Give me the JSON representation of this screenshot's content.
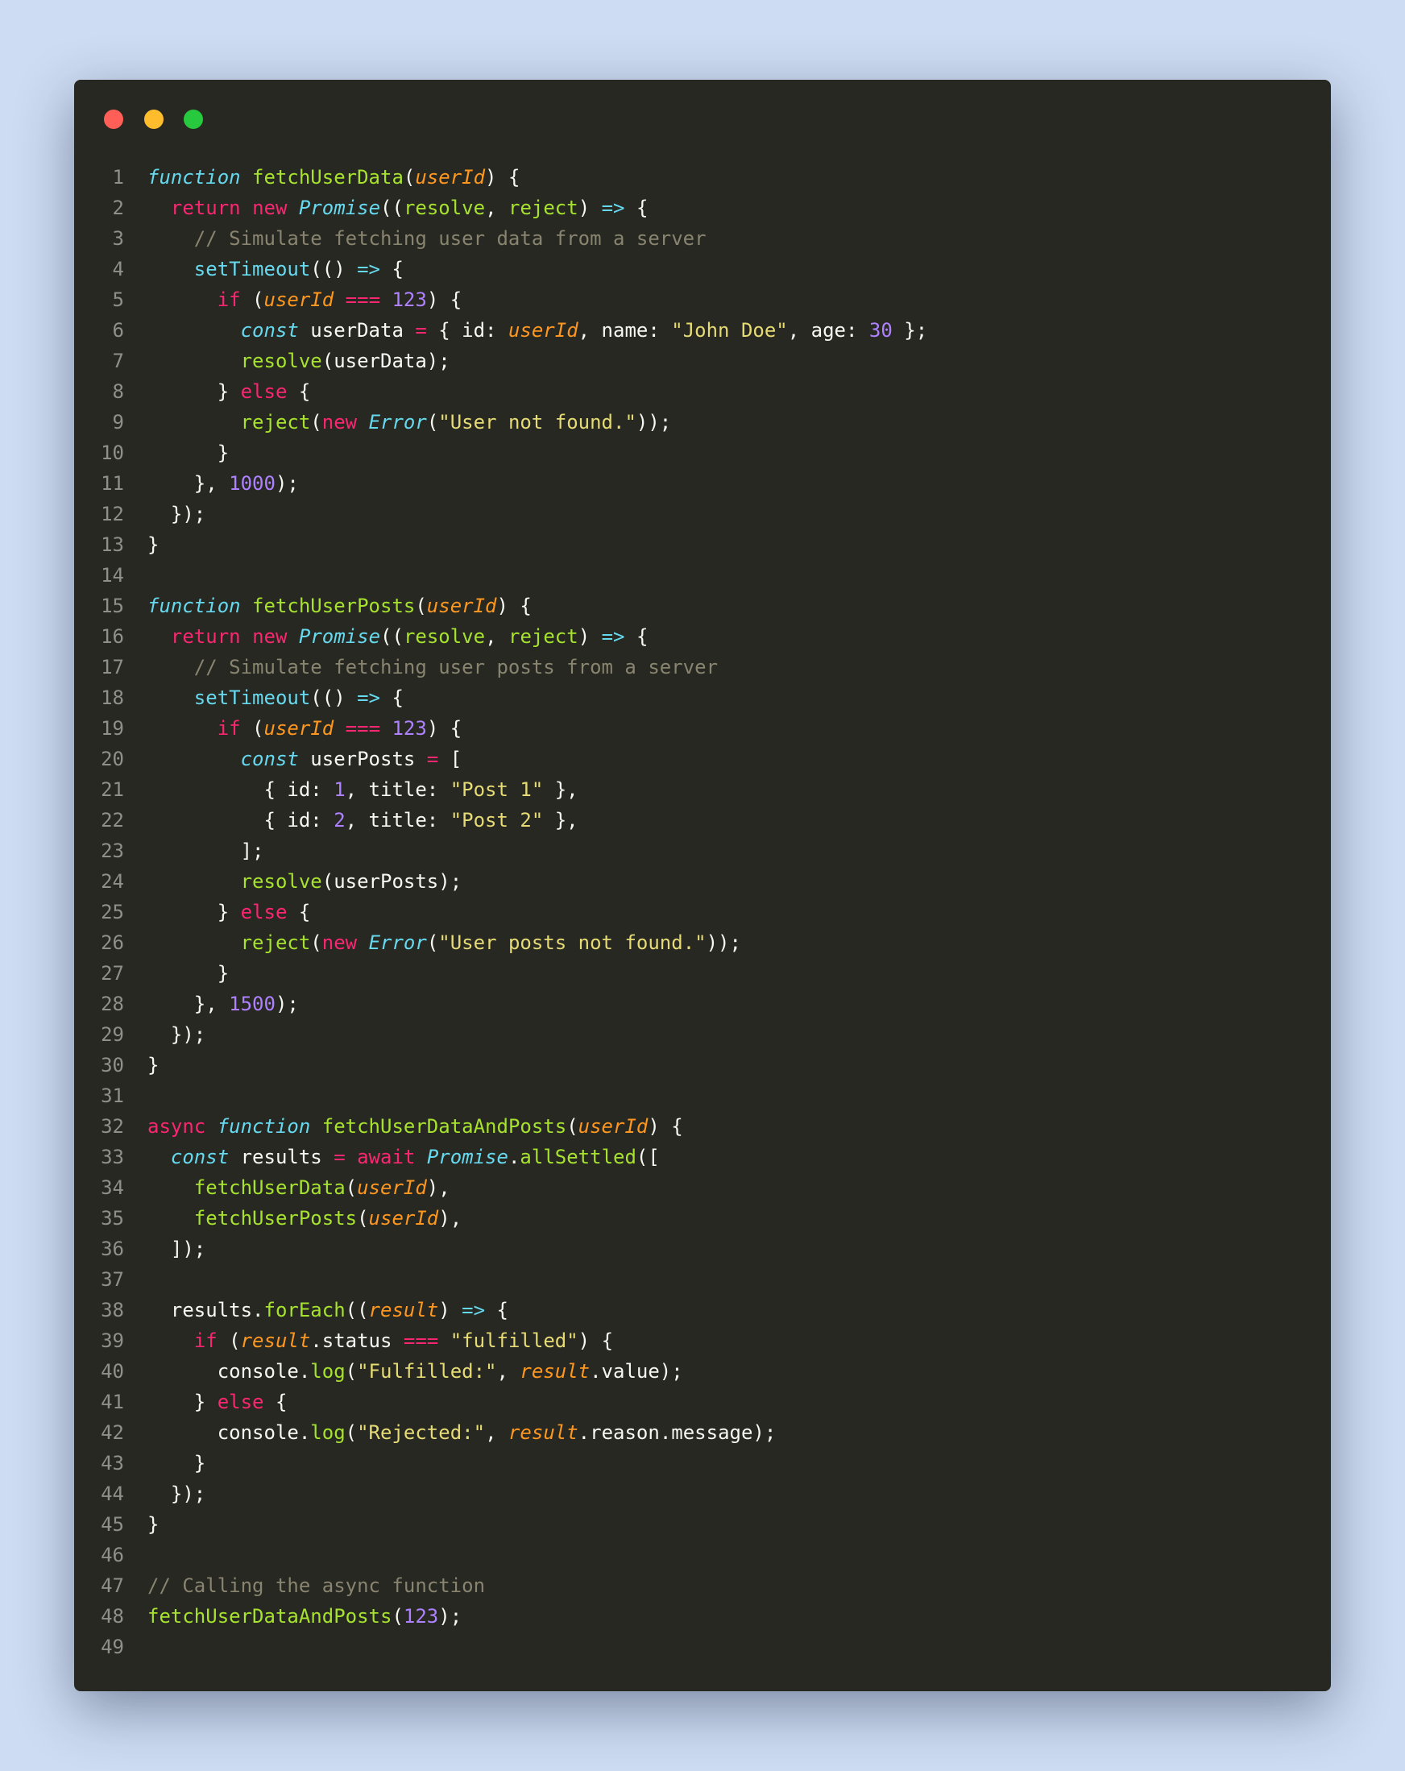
{
  "window": {
    "buttons": [
      {
        "name": "close",
        "color": "#ff5f56"
      },
      {
        "name": "minimize",
        "color": "#ffbd2e"
      },
      {
        "name": "maximize",
        "color": "#27c93f"
      }
    ]
  },
  "code": {
    "language": "javascript",
    "lines": [
      [
        [
          "st",
          "function"
        ],
        [
          "p",
          " "
        ],
        [
          "fn",
          "fetchUserData"
        ],
        [
          "p",
          "("
        ],
        [
          "prm",
          "userId"
        ],
        [
          "p",
          ") {"
        ]
      ],
      [
        [
          "p",
          "  "
        ],
        [
          "kw",
          "return"
        ],
        [
          "p",
          " "
        ],
        [
          "kw",
          "new"
        ],
        [
          "p",
          " "
        ],
        [
          "cls",
          "Promise"
        ],
        [
          "p",
          "(("
        ],
        [
          "fn",
          "resolve"
        ],
        [
          "p",
          ", "
        ],
        [
          "fn",
          "reject"
        ],
        [
          "p",
          ") "
        ],
        [
          "arrow",
          "=>"
        ],
        [
          "p",
          " {"
        ]
      ],
      [
        [
          "p",
          "    "
        ],
        [
          "cmt",
          "// Simulate fetching user data from a server"
        ]
      ],
      [
        [
          "p",
          "    "
        ],
        [
          "call",
          "setTimeout"
        ],
        [
          "p",
          "(() "
        ],
        [
          "arrow",
          "=>"
        ],
        [
          "p",
          " {"
        ]
      ],
      [
        [
          "p",
          "      "
        ],
        [
          "kw",
          "if"
        ],
        [
          "p",
          " ("
        ],
        [
          "prm",
          "userId"
        ],
        [
          "p",
          " "
        ],
        [
          "op",
          "==="
        ],
        [
          "p",
          " "
        ],
        [
          "num",
          "123"
        ],
        [
          "p",
          ") {"
        ]
      ],
      [
        [
          "p",
          "        "
        ],
        [
          "st",
          "const"
        ],
        [
          "p",
          " userData "
        ],
        [
          "op",
          "="
        ],
        [
          "p",
          " { id: "
        ],
        [
          "prm",
          "userId"
        ],
        [
          "p",
          ", name: "
        ],
        [
          "str",
          "\"John Doe\""
        ],
        [
          "p",
          ", age: "
        ],
        [
          "num",
          "30"
        ],
        [
          "p",
          " };"
        ]
      ],
      [
        [
          "p",
          "        "
        ],
        [
          "fn",
          "resolve"
        ],
        [
          "p",
          "(userData);"
        ]
      ],
      [
        [
          "p",
          "      } "
        ],
        [
          "kw",
          "else"
        ],
        [
          "p",
          " {"
        ]
      ],
      [
        [
          "p",
          "        "
        ],
        [
          "fn",
          "reject"
        ],
        [
          "p",
          "("
        ],
        [
          "kw",
          "new"
        ],
        [
          "p",
          " "
        ],
        [
          "cls",
          "Error"
        ],
        [
          "p",
          "("
        ],
        [
          "str",
          "\"User not found.\""
        ],
        [
          "p",
          "));"
        ]
      ],
      [
        [
          "p",
          "      }"
        ]
      ],
      [
        [
          "p",
          "    }, "
        ],
        [
          "num",
          "1000"
        ],
        [
          "p",
          ");"
        ]
      ],
      [
        [
          "p",
          "  });"
        ]
      ],
      [
        [
          "p",
          "}"
        ]
      ],
      [],
      [
        [
          "st",
          "function"
        ],
        [
          "p",
          " "
        ],
        [
          "fn",
          "fetchUserPosts"
        ],
        [
          "p",
          "("
        ],
        [
          "prm",
          "userId"
        ],
        [
          "p",
          ") {"
        ]
      ],
      [
        [
          "p",
          "  "
        ],
        [
          "kw",
          "return"
        ],
        [
          "p",
          " "
        ],
        [
          "kw",
          "new"
        ],
        [
          "p",
          " "
        ],
        [
          "cls",
          "Promise"
        ],
        [
          "p",
          "(("
        ],
        [
          "fn",
          "resolve"
        ],
        [
          "p",
          ", "
        ],
        [
          "fn",
          "reject"
        ],
        [
          "p",
          ") "
        ],
        [
          "arrow",
          "=>"
        ],
        [
          "p",
          " {"
        ]
      ],
      [
        [
          "p",
          "    "
        ],
        [
          "cmt",
          "// Simulate fetching user posts from a server"
        ]
      ],
      [
        [
          "p",
          "    "
        ],
        [
          "call",
          "setTimeout"
        ],
        [
          "p",
          "(() "
        ],
        [
          "arrow",
          "=>"
        ],
        [
          "p",
          " {"
        ]
      ],
      [
        [
          "p",
          "      "
        ],
        [
          "kw",
          "if"
        ],
        [
          "p",
          " ("
        ],
        [
          "prm",
          "userId"
        ],
        [
          "p",
          " "
        ],
        [
          "op",
          "==="
        ],
        [
          "p",
          " "
        ],
        [
          "num",
          "123"
        ],
        [
          "p",
          ") {"
        ]
      ],
      [
        [
          "p",
          "        "
        ],
        [
          "st",
          "const"
        ],
        [
          "p",
          " userPosts "
        ],
        [
          "op",
          "="
        ],
        [
          "p",
          " ["
        ]
      ],
      [
        [
          "p",
          "          { id: "
        ],
        [
          "num",
          "1"
        ],
        [
          "p",
          ", title: "
        ],
        [
          "str",
          "\"Post 1\""
        ],
        [
          "p",
          " },"
        ]
      ],
      [
        [
          "p",
          "          { id: "
        ],
        [
          "num",
          "2"
        ],
        [
          "p",
          ", title: "
        ],
        [
          "str",
          "\"Post 2\""
        ],
        [
          "p",
          " },"
        ]
      ],
      [
        [
          "p",
          "        ];"
        ]
      ],
      [
        [
          "p",
          "        "
        ],
        [
          "fn",
          "resolve"
        ],
        [
          "p",
          "(userPosts);"
        ]
      ],
      [
        [
          "p",
          "      } "
        ],
        [
          "kw",
          "else"
        ],
        [
          "p",
          " {"
        ]
      ],
      [
        [
          "p",
          "        "
        ],
        [
          "fn",
          "reject"
        ],
        [
          "p",
          "("
        ],
        [
          "kw",
          "new"
        ],
        [
          "p",
          " "
        ],
        [
          "cls",
          "Error"
        ],
        [
          "p",
          "("
        ],
        [
          "str",
          "\"User posts not found.\""
        ],
        [
          "p",
          "));"
        ]
      ],
      [
        [
          "p",
          "      }"
        ]
      ],
      [
        [
          "p",
          "    }, "
        ],
        [
          "num",
          "1500"
        ],
        [
          "p",
          ");"
        ]
      ],
      [
        [
          "p",
          "  });"
        ]
      ],
      [
        [
          "p",
          "}"
        ]
      ],
      [],
      [
        [
          "kw",
          "async"
        ],
        [
          "p",
          " "
        ],
        [
          "st",
          "function"
        ],
        [
          "p",
          " "
        ],
        [
          "fn",
          "fetchUserDataAndPosts"
        ],
        [
          "p",
          "("
        ],
        [
          "prm",
          "userId"
        ],
        [
          "p",
          ") {"
        ]
      ],
      [
        [
          "p",
          "  "
        ],
        [
          "st",
          "const"
        ],
        [
          "p",
          " results "
        ],
        [
          "op",
          "="
        ],
        [
          "p",
          " "
        ],
        [
          "kw",
          "await"
        ],
        [
          "p",
          " "
        ],
        [
          "cls",
          "Promise"
        ],
        [
          "p",
          "."
        ],
        [
          "fn",
          "allSettled"
        ],
        [
          "p",
          "(["
        ]
      ],
      [
        [
          "p",
          "    "
        ],
        [
          "fn",
          "fetchUserData"
        ],
        [
          "p",
          "("
        ],
        [
          "prm",
          "userId"
        ],
        [
          "p",
          "),"
        ]
      ],
      [
        [
          "p",
          "    "
        ],
        [
          "fn",
          "fetchUserPosts"
        ],
        [
          "p",
          "("
        ],
        [
          "prm",
          "userId"
        ],
        [
          "p",
          "),"
        ]
      ],
      [
        [
          "p",
          "  ]);"
        ]
      ],
      [],
      [
        [
          "p",
          "  results."
        ],
        [
          "fn",
          "forEach"
        ],
        [
          "p",
          "(("
        ],
        [
          "prm",
          "result"
        ],
        [
          "p",
          ") "
        ],
        [
          "arrow",
          "=>"
        ],
        [
          "p",
          " {"
        ]
      ],
      [
        [
          "p",
          "    "
        ],
        [
          "kw",
          "if"
        ],
        [
          "p",
          " ("
        ],
        [
          "prm",
          "result"
        ],
        [
          "p",
          ".status "
        ],
        [
          "op",
          "==="
        ],
        [
          "p",
          " "
        ],
        [
          "str",
          "\"fulfilled\""
        ],
        [
          "p",
          ") {"
        ]
      ],
      [
        [
          "p",
          "      console."
        ],
        [
          "fn",
          "log"
        ],
        [
          "p",
          "("
        ],
        [
          "str",
          "\"Fulfilled:\""
        ],
        [
          "p",
          ", "
        ],
        [
          "prm",
          "result"
        ],
        [
          "p",
          ".value);"
        ]
      ],
      [
        [
          "p",
          "    } "
        ],
        [
          "kw",
          "else"
        ],
        [
          "p",
          " {"
        ]
      ],
      [
        [
          "p",
          "      console."
        ],
        [
          "fn",
          "log"
        ],
        [
          "p",
          "("
        ],
        [
          "str",
          "\"Rejected:\""
        ],
        [
          "p",
          ", "
        ],
        [
          "prm",
          "result"
        ],
        [
          "p",
          ".reason.message);"
        ]
      ],
      [
        [
          "p",
          "    }"
        ]
      ],
      [
        [
          "p",
          "  });"
        ]
      ],
      [
        [
          "p",
          "}"
        ]
      ],
      [],
      [
        [
          "cmt",
          "// Calling the async function"
        ]
      ],
      [
        [
          "fn",
          "fetchUserDataAndPosts"
        ],
        [
          "p",
          "("
        ],
        [
          "num",
          "123"
        ],
        [
          "p",
          ");"
        ]
      ],
      []
    ]
  }
}
